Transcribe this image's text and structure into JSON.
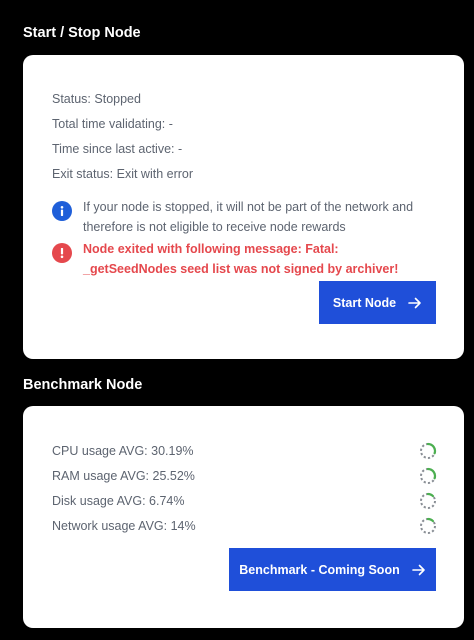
{
  "node": {
    "section_title": "Start / Stop Node",
    "status": "Status: Stopped",
    "total_time": "Total time validating: -",
    "since_active": "Time since last active: -",
    "exit_status": "Exit status: Exit with error",
    "info_message": "If your node is stopped, it will not be part of the network and therefore is not eligible to receive node rewards",
    "error_message": "Node exited with following message: Fatal: _getSeedNodes seed list was not signed by archiver!",
    "start_button": "Start Node"
  },
  "benchmark": {
    "section_title": "Benchmark Node",
    "items": [
      {
        "label": "CPU usage AVG: 30.19%"
      },
      {
        "label": "RAM usage AVG: 25.52%"
      },
      {
        "label": "Disk usage AVG: 6.74%"
      },
      {
        "label": "Network usage AVG: 14%"
      }
    ],
    "button": "Benchmark - Coming Soon"
  },
  "colors": {
    "accent": "#1f4fd9",
    "error": "#e5484d",
    "info": "#1f5fd9",
    "spinner_active": "#4caf50",
    "spinner_track": "#8a8f96"
  }
}
